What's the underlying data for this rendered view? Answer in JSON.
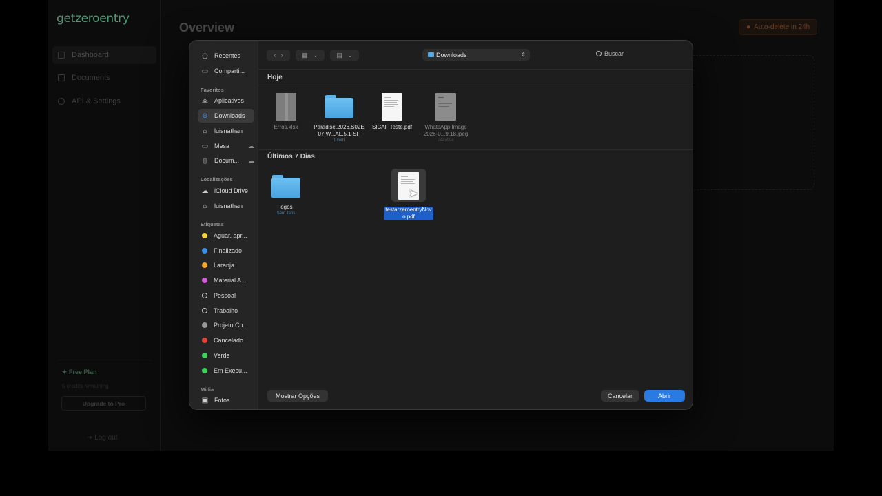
{
  "app": {
    "logo_prefix": "get",
    "logo_brand": "zeroentry",
    "nav": [
      {
        "label": "Dashboard"
      },
      {
        "label": "Documents"
      },
      {
        "label": "API & Settings"
      }
    ],
    "plan_title": "Free Plan",
    "plan_sub": "5 credits remaining",
    "upgrade_label": "Upgrade to Pro",
    "logout_label": "Log out",
    "page_title": "Overview",
    "autodelete_label": "Auto-delete in 24h"
  },
  "dialog": {
    "sidebar": {
      "items_top": [
        {
          "label": "Recentes",
          "icon": "clock-icon"
        },
        {
          "label": "Comparti...",
          "icon": "shared-folder-icon"
        }
      ],
      "favorites_header": "Favoritos",
      "favorites": [
        {
          "label": "Aplicativos",
          "icon": "apps-icon"
        },
        {
          "label": "Downloads",
          "icon": "download-icon",
          "selected": true
        },
        {
          "label": "luisnathan",
          "icon": "home-icon"
        },
        {
          "label": "Mesa",
          "icon": "desktop-icon",
          "cloud": true
        },
        {
          "label": "Docum...",
          "icon": "document-icon",
          "cloud": true
        }
      ],
      "locations_header": "Localizações",
      "locations": [
        {
          "label": "iCloud Drive",
          "icon": "cloud-icon"
        },
        {
          "label": "luisnathan",
          "icon": "home-icon"
        }
      ],
      "tags_header": "Etiquetas",
      "tags": [
        {
          "label": "Aguar. apr...",
          "color": "#f5d43a"
        },
        {
          "label": "Finalizado",
          "color": "#3a8fe8"
        },
        {
          "label": "Laranja",
          "color": "#f5a623"
        },
        {
          "label": "Material A...",
          "color": "#d05ad8"
        },
        {
          "label": "Pessoal",
          "color": "hollow"
        },
        {
          "label": "Trabalho",
          "color": "hollow"
        },
        {
          "label": "Projeto Co...",
          "color": "#9a9a9a"
        },
        {
          "label": "Cancelado",
          "color": "#e8413c"
        },
        {
          "label": "Verde",
          "color": "#3bd25a"
        },
        {
          "label": "Em Execu...",
          "color": "#3bd25a"
        }
      ],
      "media_header": "Mídia",
      "media": [
        {
          "label": "Fotos",
          "icon": "photos-icon"
        }
      ]
    },
    "toolbar": {
      "location": "Downloads",
      "search_placeholder": "Buscar"
    },
    "sections": [
      {
        "title": "Hoje",
        "files": [
          {
            "name": "Erros.xlsx",
            "meta": "",
            "kind": "xlsx",
            "dim": true
          },
          {
            "name": "Paradise.2026.S02E07.W...AL.5.1-SF",
            "meta": "1 item",
            "kind": "folder",
            "dim": false
          },
          {
            "name": "SICAF Teste.pdf",
            "meta": "",
            "kind": "doc",
            "dim": false
          },
          {
            "name": "WhatsApp Image 2026-0...9.18.jpeg",
            "meta": "744×994",
            "kind": "doc",
            "dim": true
          }
        ]
      },
      {
        "title": "Últimos 7 Dias",
        "files": [
          {
            "name": "logos",
            "meta": "Sem itens",
            "kind": "folder",
            "dim": false
          },
          {
            "name": "testarzeroentryNovo.pdf",
            "meta": "",
            "kind": "doc",
            "dim": false,
            "selected": true
          }
        ]
      }
    ],
    "options_label": "Mostrar Opções",
    "cancel_label": "Cancelar",
    "open_label": "Abrir"
  }
}
